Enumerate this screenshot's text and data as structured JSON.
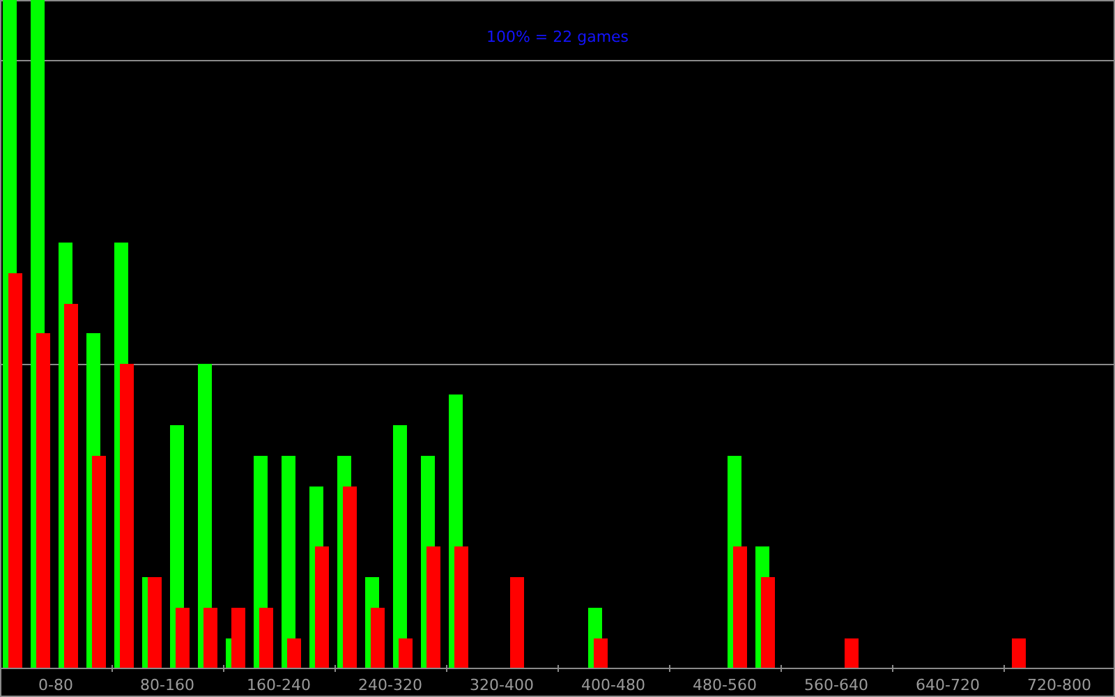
{
  "histogram": {
    "title": "100% = 22 games",
    "axis_labels": [
      "0-80",
      "80-160",
      "160-240",
      "240-320",
      "320-400",
      "400-480",
      "480-560",
      "560-640",
      "640-720",
      "720-800"
    ]
  }
}
